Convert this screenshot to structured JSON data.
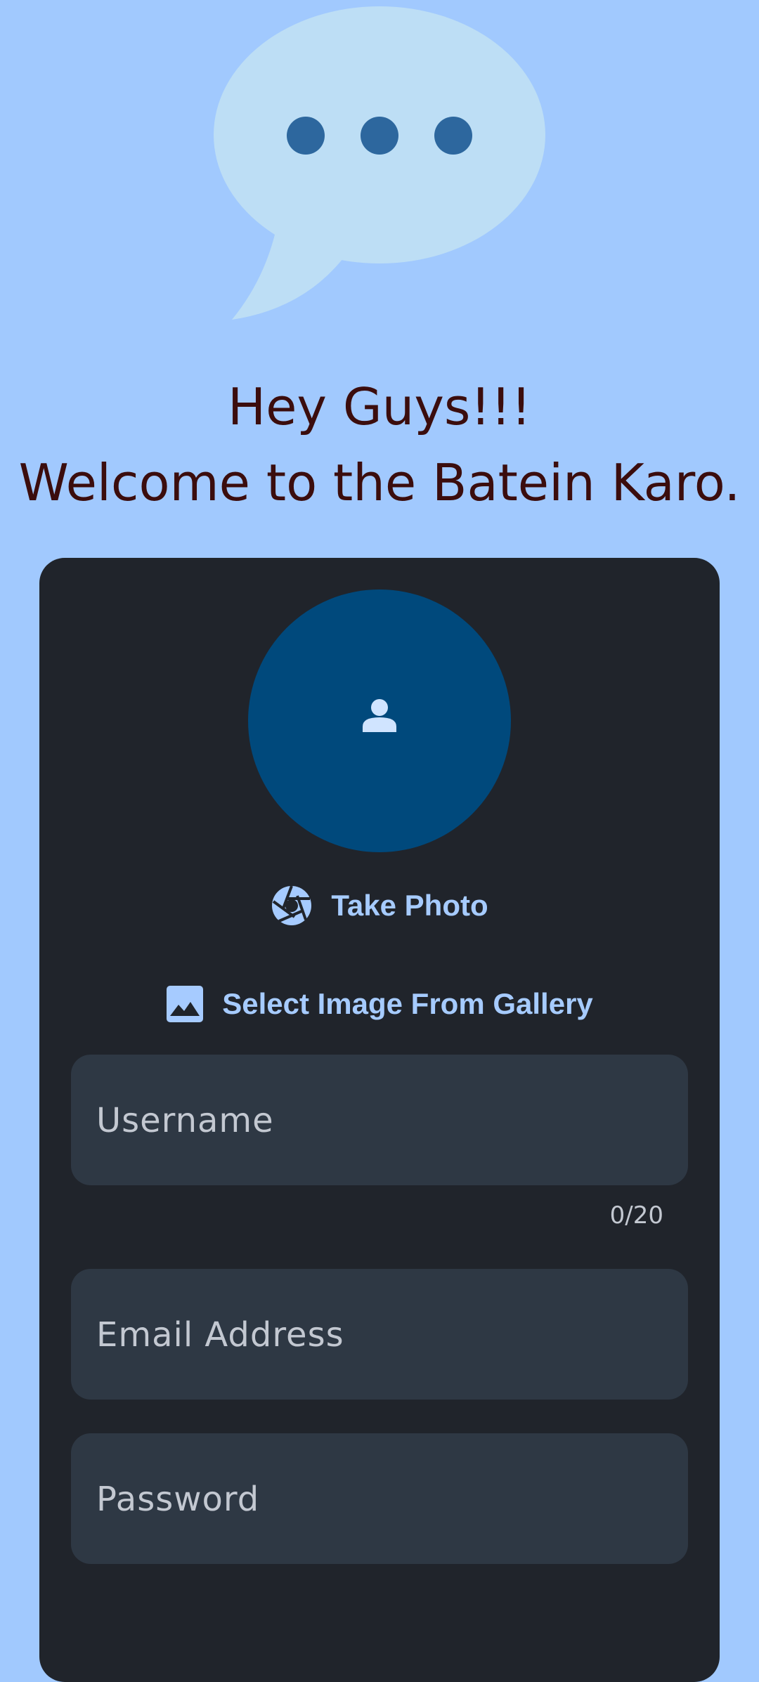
{
  "logo": {
    "icon": "chat-bubble-icon"
  },
  "greeting": {
    "line1": "Hey Guys!!!",
    "line2": "Welcome to the Batein Karo."
  },
  "profile": {
    "avatar_icon": "person-icon",
    "take_photo_icon": "camera-shutter-icon",
    "take_photo_label": "Take Photo",
    "gallery_icon": "image-icon",
    "gallery_label": "Select Image From Gallery"
  },
  "form": {
    "username": {
      "value": "",
      "placeholder": "Username",
      "counter": "0/20"
    },
    "email": {
      "value": "",
      "placeholder": "Email Address"
    },
    "password": {
      "value": "",
      "placeholder": "Password"
    }
  },
  "colors": {
    "background": "#a1c9fe",
    "card": "#20242b",
    "field": "#2e3844",
    "accent": "#a6cbff",
    "avatar": "#00497c",
    "greeting_text": "#3b0d0d"
  }
}
